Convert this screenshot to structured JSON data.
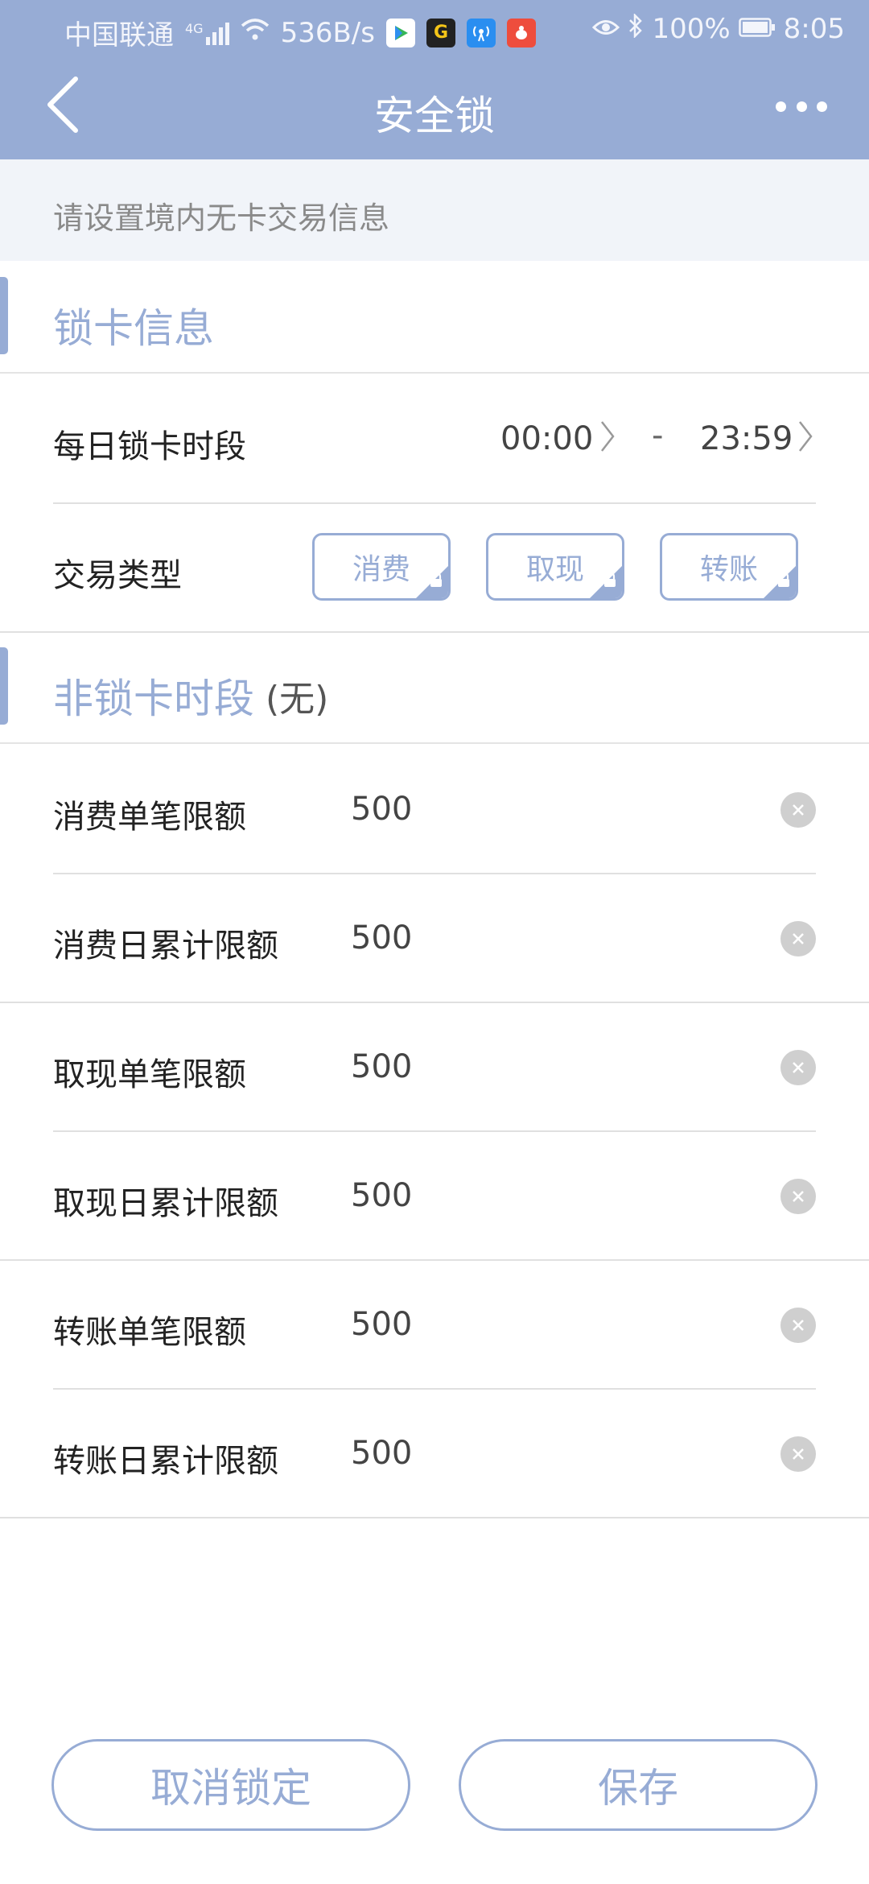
{
  "status_bar": {
    "carrier": "中国联通",
    "network": "4G",
    "speed": "536B/s",
    "battery": "100%",
    "time": "8:05",
    "app_icons": [
      "video-app-icon",
      "g-app-icon",
      "antenna-app-icon",
      "red-app-icon"
    ]
  },
  "nav": {
    "title": "安全锁",
    "back_icon": "chevron-left-icon",
    "more_icon": "more-dots-icon"
  },
  "hint": "请设置境内无卡交易信息",
  "lock_section": {
    "title": "锁卡信息",
    "daily_period": {
      "label": "每日锁卡时段",
      "start": "00:00",
      "separator": "-",
      "end": "23:59"
    },
    "trade_type": {
      "label": "交易类型",
      "options": [
        "消费",
        "取现",
        "转账"
      ]
    }
  },
  "unlock_section": {
    "title": "非锁卡时段",
    "suffix": "(无)",
    "limits": [
      {
        "label": "消费单笔限额",
        "value": "500"
      },
      {
        "label": "消费日累计限额",
        "value": "500"
      },
      {
        "label": "取现单笔限额",
        "value": "500"
      },
      {
        "label": "取现日累计限额",
        "value": "500"
      },
      {
        "label": "转账单笔限额",
        "value": "500"
      },
      {
        "label": "转账日累计限额",
        "value": "500"
      }
    ]
  },
  "actions": {
    "cancel": "取消锁定",
    "save": "保存"
  },
  "colors": {
    "accent": "#97acd5",
    "hint_bg": "#f1f4f9"
  }
}
